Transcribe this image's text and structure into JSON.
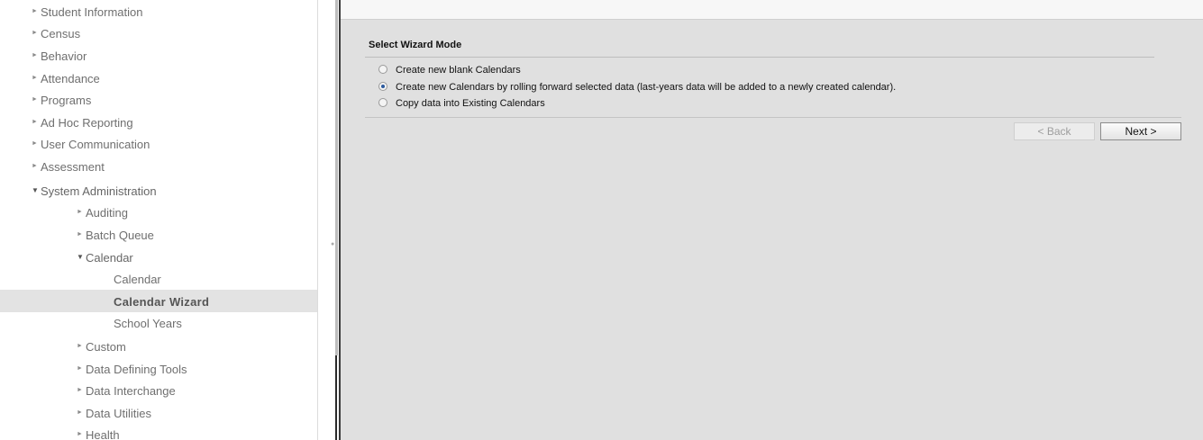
{
  "sidebar": {
    "items": [
      {
        "label": "Student Information",
        "level": 0,
        "state": "collapsed"
      },
      {
        "label": "Census",
        "level": 0,
        "state": "collapsed"
      },
      {
        "label": "Behavior",
        "level": 0,
        "state": "collapsed"
      },
      {
        "label": "Attendance",
        "level": 0,
        "state": "collapsed"
      },
      {
        "label": "Programs",
        "level": 0,
        "state": "collapsed"
      },
      {
        "label": "Ad Hoc Reporting",
        "level": 0,
        "state": "collapsed"
      },
      {
        "label": "User Communication",
        "level": 0,
        "state": "collapsed"
      },
      {
        "label": "Assessment",
        "level": 0,
        "state": "collapsed"
      },
      {
        "label": "System Administration",
        "level": 0,
        "state": "expanded"
      },
      {
        "label": "Auditing",
        "level": 1,
        "state": "collapsed"
      },
      {
        "label": "Batch Queue",
        "level": 1,
        "state": "collapsed"
      },
      {
        "label": "Calendar",
        "level": 1,
        "state": "expanded"
      },
      {
        "label": "Calendar",
        "level": 2,
        "state": "leaf"
      },
      {
        "label": "Calendar Wizard",
        "level": 2,
        "state": "selected"
      },
      {
        "label": "School Years",
        "level": 2,
        "state": "leaf"
      },
      {
        "label": "Custom",
        "level": 1,
        "state": "collapsed"
      },
      {
        "label": "Data Defining Tools",
        "level": 1,
        "state": "collapsed"
      },
      {
        "label": "Data Interchange",
        "level": 1,
        "state": "collapsed"
      },
      {
        "label": "Data Utilities",
        "level": 1,
        "state": "collapsed"
      },
      {
        "label": "Health",
        "level": 1,
        "state": "collapsed"
      }
    ]
  },
  "icons": {
    "collapsed": "triangle-right-icon",
    "expanded": "triangle-down-icon",
    "splitter": "drag-grip-icon"
  },
  "wizard": {
    "section_title": "Select Wizard Mode",
    "options": [
      {
        "label": "Create new blank Calendars",
        "checked": false
      },
      {
        "label": "Create new Calendars by rolling forward selected data (last-years data will be added to a newly created calendar).",
        "checked": true
      },
      {
        "label": "Copy data into Existing Calendars",
        "checked": false
      }
    ],
    "back_label": "< Back",
    "back_enabled": false,
    "next_label": "Next >"
  },
  "colors": {
    "content_background": "#e0e0e0",
    "selected_item_background": "#e3e3e3",
    "radio_selected": "#2c5a9e"
  }
}
